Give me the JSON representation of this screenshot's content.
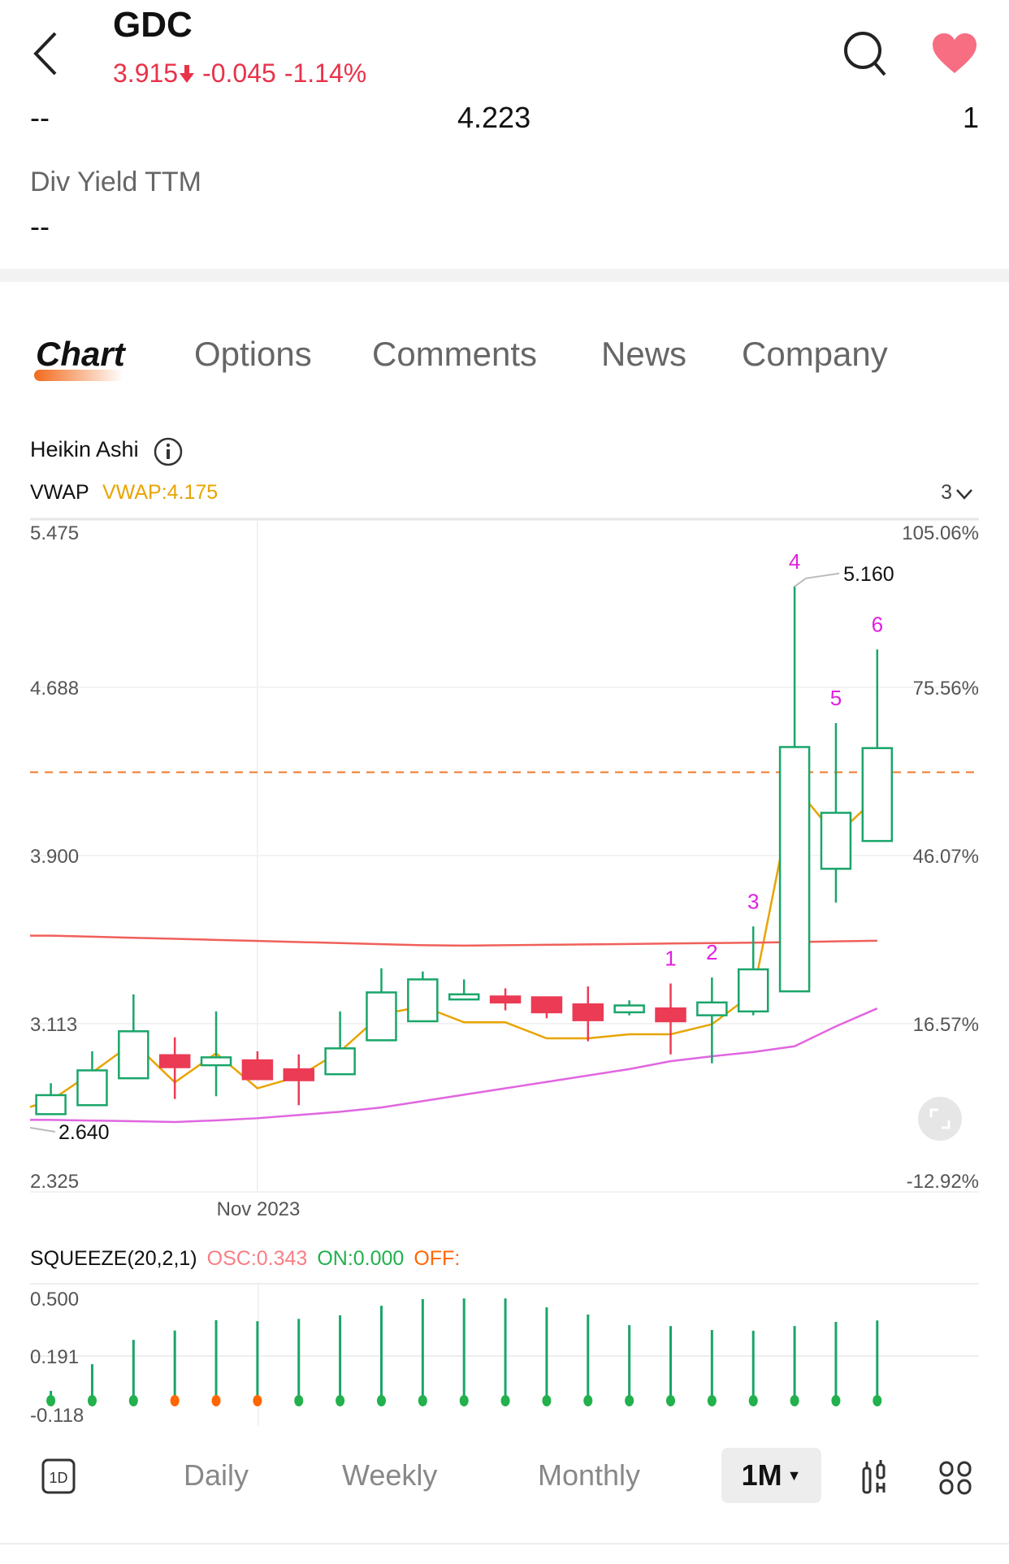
{
  "header": {
    "ticker": "GDC",
    "price": "3.915",
    "change": "-0.045",
    "change_pct": "-1.14%",
    "down_color": "#e8334a",
    "heart_color": "#f76e82",
    "icons": [
      "back-chevron-icon",
      "search-icon",
      "heart-icon"
    ]
  },
  "stats": {
    "left": "--",
    "middle": "4.223",
    "right": "1",
    "div_yield_label": "Div Yield TTM",
    "div_yield_value": "--"
  },
  "tabs": [
    {
      "label": "Chart",
      "active": true
    },
    {
      "label": "Options"
    },
    {
      "label": "Comments"
    },
    {
      "label": "News"
    },
    {
      "label": "Company"
    }
  ],
  "chart_header": {
    "type_label": "Heikin Ashi",
    "indicator": "VWAP",
    "vwap_value": "VWAP:4.175",
    "vwap_color": "#e8a400",
    "count": "3"
  },
  "chart_data": [
    {
      "type": "candlestick",
      "style": "Heikin Ashi",
      "x_tick_label": "Nov 2023",
      "x_tick_index": 5,
      "ylim": [
        2.325,
        5.475
      ],
      "y_ticks": [
        "5.475",
        "4.688",
        "3.900",
        "3.113",
        "2.325"
      ],
      "y_ticks_right": [
        "105.06%",
        "75.56%",
        "46.07%",
        "16.57%",
        "-12.92%"
      ],
      "grid": true,
      "up_color": "#1aa56a",
      "down_color": "#eb3b55",
      "candles": [
        {
          "o": 2.689,
          "h": 2.834,
          "l": 2.689,
          "c": 2.778
        },
        {
          "o": 2.731,
          "h": 2.983,
          "l": 2.731,
          "c": 2.894
        },
        {
          "o": 2.857,
          "h": 3.25,
          "l": 2.857,
          "c": 3.077
        },
        {
          "o": 2.965,
          "h": 3.049,
          "l": 2.76,
          "c": 2.909
        },
        {
          "o": 2.918,
          "h": 3.17,
          "l": 2.773,
          "c": 2.955
        },
        {
          "o": 2.941,
          "h": 2.983,
          "l": 2.848,
          "c": 2.853
        },
        {
          "o": 2.899,
          "h": 2.969,
          "l": 2.731,
          "c": 2.848
        },
        {
          "o": 2.876,
          "h": 3.17,
          "l": 2.876,
          "c": 2.997
        },
        {
          "o": 3.035,
          "h": 3.372,
          "l": 3.035,
          "c": 3.259
        },
        {
          "o": 3.124,
          "h": 3.357,
          "l": 3.124,
          "c": 3.32
        },
        {
          "o": 3.226,
          "h": 3.32,
          "l": 3.226,
          "c": 3.25
        },
        {
          "o": 3.24,
          "h": 3.278,
          "l": 3.175,
          "c": 3.212
        },
        {
          "o": 3.236,
          "h": 3.236,
          "l": 3.138,
          "c": 3.166
        },
        {
          "o": 3.203,
          "h": 3.287,
          "l": 3.03,
          "c": 3.129
        },
        {
          "o": 3.166,
          "h": 3.222,
          "l": 3.152,
          "c": 3.198
        },
        {
          "o": 3.184,
          "h": 3.301,
          "l": 2.969,
          "c": 3.124
        },
        {
          "o": 3.152,
          "h": 3.329,
          "l": 2.927,
          "c": 3.212
        },
        {
          "o": 3.17,
          "h": 3.568,
          "l": 3.152,
          "c": 3.367
        },
        {
          "o": 3.264,
          "h": 5.16,
          "l": 3.264,
          "c": 4.408
        },
        {
          "o": 3.838,
          "h": 4.52,
          "l": 3.68,
          "c": 4.1
        },
        {
          "o": 3.968,
          "h": 4.865,
          "l": 3.968,
          "c": 4.403
        }
      ],
      "series": [
        {
          "name": "VWAP",
          "color": "#e8a400",
          "values": [
            2.753,
            2.884,
            3.024,
            2.838,
            2.974,
            2.81,
            2.866,
            2.983,
            3.156,
            3.194,
            3.119,
            3.119,
            3.044,
            3.044,
            3.063,
            3.063,
            3.11,
            3.254,
            4.226,
            3.992,
            4.175
          ]
        },
        {
          "color": "#f0605a",
          "values": [
            3.525,
            3.52,
            3.515,
            3.51,
            3.505,
            3.5,
            3.495,
            3.49,
            3.485,
            3.48,
            3.478,
            3.48,
            3.482,
            3.484,
            3.486,
            3.488,
            3.49,
            3.492,
            3.495,
            3.498,
            3.501
          ]
        },
        {
          "color": "#e066e0",
          "values": [
            2.662,
            2.659,
            2.656,
            2.652,
            2.66,
            2.67,
            2.685,
            2.7,
            2.72,
            2.75,
            2.78,
            2.81,
            2.84,
            2.87,
            2.9,
            2.937,
            2.96,
            2.98,
            3.007,
            3.1,
            3.184
          ]
        }
      ],
      "reference_line": {
        "value": 4.29,
        "color": "#f07a2a",
        "style": "dashed"
      },
      "annotations": [
        {
          "text": "1",
          "index": 15
        },
        {
          "text": "2",
          "index": 16
        },
        {
          "text": "3",
          "index": 17
        },
        {
          "text": "4",
          "index": 18
        },
        {
          "text": "5",
          "index": 19
        },
        {
          "text": "6",
          "index": 20
        }
      ],
      "annotation_color": "#e020e0",
      "high_label": "5.160",
      "low_label": "2.640"
    },
    {
      "type": "bar",
      "title": "SQUEEZE(20,2,1)",
      "osc_label": "OSC:0.343",
      "on_label": "ON:0.000",
      "off_label": "OFF:",
      "osc_color": "#f87e84",
      "on_color": "#22b14c",
      "off_color": "#ff6600",
      "y_ticks": [
        "0.500",
        "0.191",
        "-0.118"
      ],
      "ylim": [
        -0.118,
        0.5
      ],
      "values": [
        0.042,
        0.156,
        0.26,
        0.3,
        0.344,
        0.34,
        0.35,
        0.365,
        0.406,
        0.434,
        0.437,
        0.437,
        0.399,
        0.368,
        0.323,
        0.319,
        0.302,
        0.299,
        0.319,
        0.337,
        0.343
      ],
      "dot_states": [
        "on",
        "on",
        "on",
        "off",
        "off",
        "off",
        "on",
        "on",
        "on",
        "on",
        "on",
        "on",
        "on",
        "on",
        "on",
        "on",
        "on",
        "on",
        "on",
        "on",
        "on"
      ]
    }
  ],
  "bottom_bar": {
    "day_icon_label": "1D",
    "daily": "Daily",
    "weekly": "Weekly",
    "monthly": "Monthly",
    "selected": "1M",
    "icons": [
      "indicator-icon",
      "grid-icon"
    ]
  }
}
